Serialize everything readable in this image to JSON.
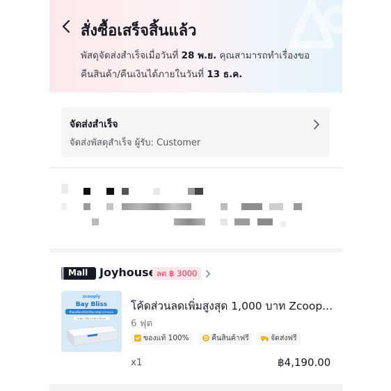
{
  "header": {
    "title": "สั่งซื้อเสร็จสิ้นแล้ว",
    "line1_prefix": "พัสดุจัดส่งสำเร็จเมื่อวันที่ ",
    "line1_date": "28 พ.ย.",
    "line1_suffix": " คุณสามารถทำเรื่องขอ",
    "line2_prefix": "คืนสินค้า/คืนเงินได้ภายในวันที่ ",
    "line2_date": "13 ธ.ค."
  },
  "shipping": {
    "status": "จัดส่งสำเร็จ",
    "detail": "จัดส่งพัสดุสำเร็จ ผู้รับ: Customer"
  },
  "shop": {
    "badge": "Mall",
    "name": "Joyhouse",
    "discount": "ลด ฿ 3000"
  },
  "product": {
    "title": "โค้ดส่วนลดเพิ่มสูงสุด 1,000 บาท Zcoop...",
    "variant": "6 ฟุต",
    "badges": [
      {
        "label": "ของแท้ 100%",
        "icon": "authentic-icon",
        "color": "#f0b428"
      },
      {
        "label": "คืนสินค้าฟรี",
        "icon": "free-return-icon",
        "color": "#f0b428"
      },
      {
        "label": "จัดส่งฟรี",
        "icon": "free-shipping-icon",
        "color": "#f0b428"
      }
    ],
    "quantity": "x1",
    "price": "฿4,190.00",
    "thumbnail": {
      "brand": "zcooply",
      "name": "Bay Bliss",
      "tagline": "ที่นอนพ็อกเก็ตสปริงมาตรฐานโรงแรม",
      "size": "6 ฟุต - 180 x 190 x 30 cm"
    }
  },
  "colors": {
    "accent": "#fe2c55",
    "text": "#161823",
    "muted": "#7a7b80",
    "card": "#f5f5f6"
  }
}
